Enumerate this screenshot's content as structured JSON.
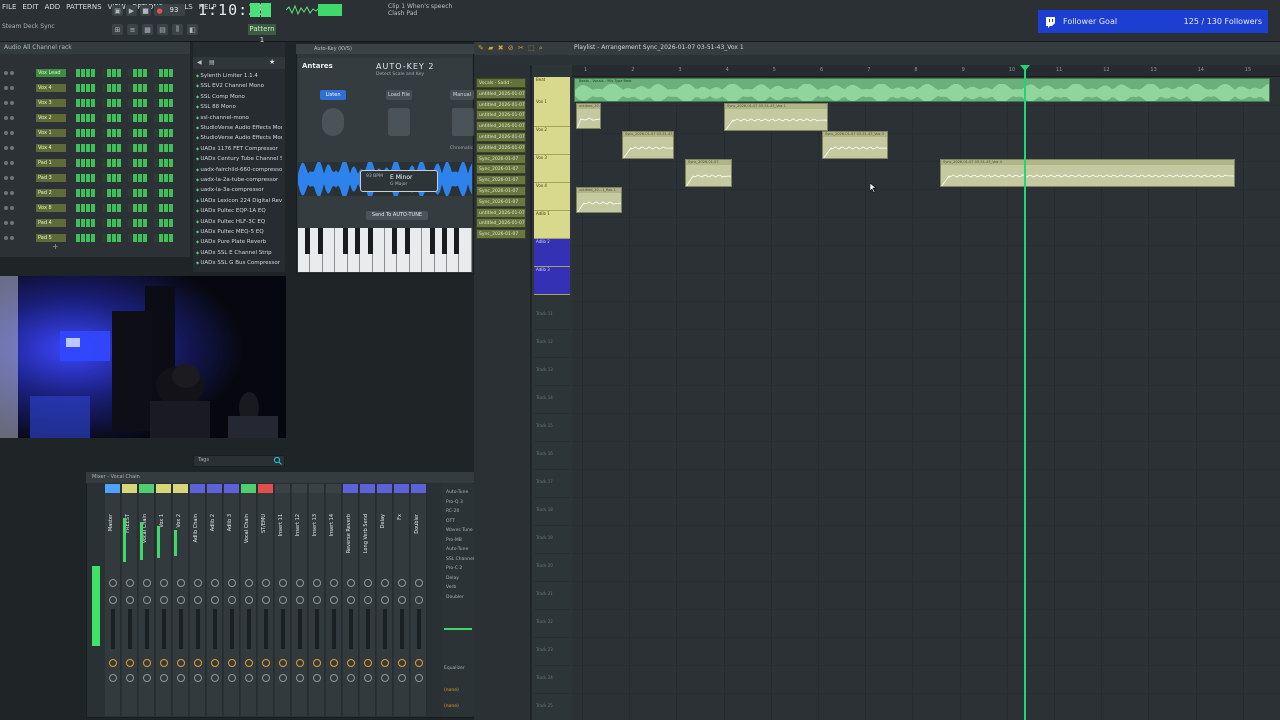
{
  "toolbar": {
    "menu": [
      "FILE",
      "EDIT",
      "ADD",
      "PATTERNS",
      "VIEW",
      "OPTIONS",
      "TOOLS",
      "HELP"
    ],
    "tempo": "93",
    "time": "1:10:39",
    "pattern_label": "Pattern 1",
    "hint": "Steam Deck Sync",
    "cpu_lines": [
      "Clip 1 When's speech",
      "Clash Pad"
    ]
  },
  "follower_goal": {
    "label": "Follower Goal",
    "count": "125 / 130 Followers"
  },
  "channel_rack": {
    "header": "Audio   All   Channel rack",
    "channels": [
      "Vox Lead",
      "Vox 4",
      "Vox 3",
      "Vox 2",
      "Vox 1",
      "Vox 4",
      "Pad 1",
      "Pad 3",
      "Pad 2",
      "Vox 8",
      "Pad 4",
      "Pad 5"
    ]
  },
  "browser": {
    "items": [
      "Sylenth Limiter 1.1.4",
      "SSL EV2 Channel Mono",
      "SSL Comp Mono",
      "SSL 88 Mono",
      "ssl-channel-mono",
      "StudioVerse Audio Effects Mono",
      "StudioVerse Audio Effects Mono Stereo",
      "UADx 1176 FET Compressor",
      "UADx Century Tube Channel Strip",
      "uadx-fairchild-660-compressor",
      "uadx-la-2a-tube-compressor",
      "uadx-la-3a-compressor",
      "UADx Lexicon 224 Digital Reverb",
      "UADx Pultec EQP-1A EQ",
      "UADx Pultec HLF-3C EQ",
      "UADx Pultec MEQ-5 EQ",
      "UADx Pure Plate Reverb",
      "UADx SSL E Channel Strip",
      "UADx SSL G Bus Compressor"
    ]
  },
  "plugin": {
    "window_title": "Auto-Key (KVS)",
    "brand": "Antares",
    "title": "AUTO-KEY 2",
    "subtitle": "Detect Scale and Key",
    "listen": "Listen",
    "file": "Load File",
    "manual": "Manual",
    "chromatic": "Chromatic",
    "detected_key": "E Minor",
    "detected_alt": "G Major",
    "bpm": "93 BPM",
    "send": "Send To AUTO-TUNE"
  },
  "search": {
    "placeholder": "Tags"
  },
  "mixer": {
    "title": "Mixer - Vocal Chain",
    "channels": [
      "Master",
      "FREEST",
      "Vocal Chain",
      "Vox 1",
      "Vox 2",
      "Adlib Chain",
      "Adlib 2",
      "Adlib 3",
      "Vocal Chain",
      "ST/EMU",
      "Insert 11",
      "Insert 12",
      "Insert 13",
      "Insert 14",
      "Reverse Reverb",
      "Long Verb Send",
      "Delay",
      "Fx",
      "Doubler"
    ],
    "inserts": [
      "Auto-Tune",
      "Pro-Q 3",
      "RC-20",
      "OTT",
      "Waves Tune",
      "Pro-MB",
      "Auto-Tune",
      "SSL Channel",
      "Pro-C 2",
      "Delay",
      "Verb",
      "Doubler"
    ],
    "footer_label": "Equalizer",
    "footer_items": [
      "(none)",
      "(none)"
    ]
  },
  "playlist": {
    "title": "Playlist - Arrangement  Sync_2026-01-07 03-51-43_Vox 1",
    "patterns": [
      "Vocals - Sadd - Rapp",
      "untitled_2026-01-07",
      "untitled_2026-01-07",
      "untitled_2026-01-07",
      "untitled_2026-01-07",
      "untitled_2026-01-07",
      "untitled_2026-01-07",
      "Sync_2026-01-07",
      "Sync_2026-01-07",
      "Sync_2026-01-07",
      "Sync_2026-01-07",
      "Sync_2026-01-07",
      "untitled_2026-01-07",
      "untitled_2026-01-07",
      "Sync_2026-01-07"
    ],
    "tracks": [
      "Beat",
      "Vox 1",
      "Vox 2",
      "Vox 3",
      "Vox 4",
      "Adlib 1",
      "Adlib 2",
      "Adlib 3"
    ],
    "empty_tracks": [
      "Track 11",
      "Track 12",
      "Track 13",
      "Track 14",
      "Track 15",
      "Track 16",
      "Track 17",
      "Track 18",
      "Track 19",
      "Track 20",
      "Track 21",
      "Track 22",
      "Track 23",
      "Track 24",
      "Track 25"
    ],
    "timeline": [
      "1",
      "2",
      "3",
      "4",
      "5",
      "6",
      "7",
      "8",
      "9",
      "10",
      "11",
      "12",
      "13",
      "14",
      "15"
    ],
    "beat_clip": "Beats - Vocals - 90s Type Beat",
    "clips": [
      "untitled_20...l_Ras 1",
      "Sync_2026-01-07 03-51-43_Vox 1",
      "Sync_2026-01-07 03-51-43_Vox 2",
      "Sync_2026-01-07 03-51-43_Vox 3",
      "Sync_2026-01-07",
      "Sync_2026-01-07 03-51-43_Vox 4",
      "untitled_20...1_Ras 1"
    ]
  }
}
